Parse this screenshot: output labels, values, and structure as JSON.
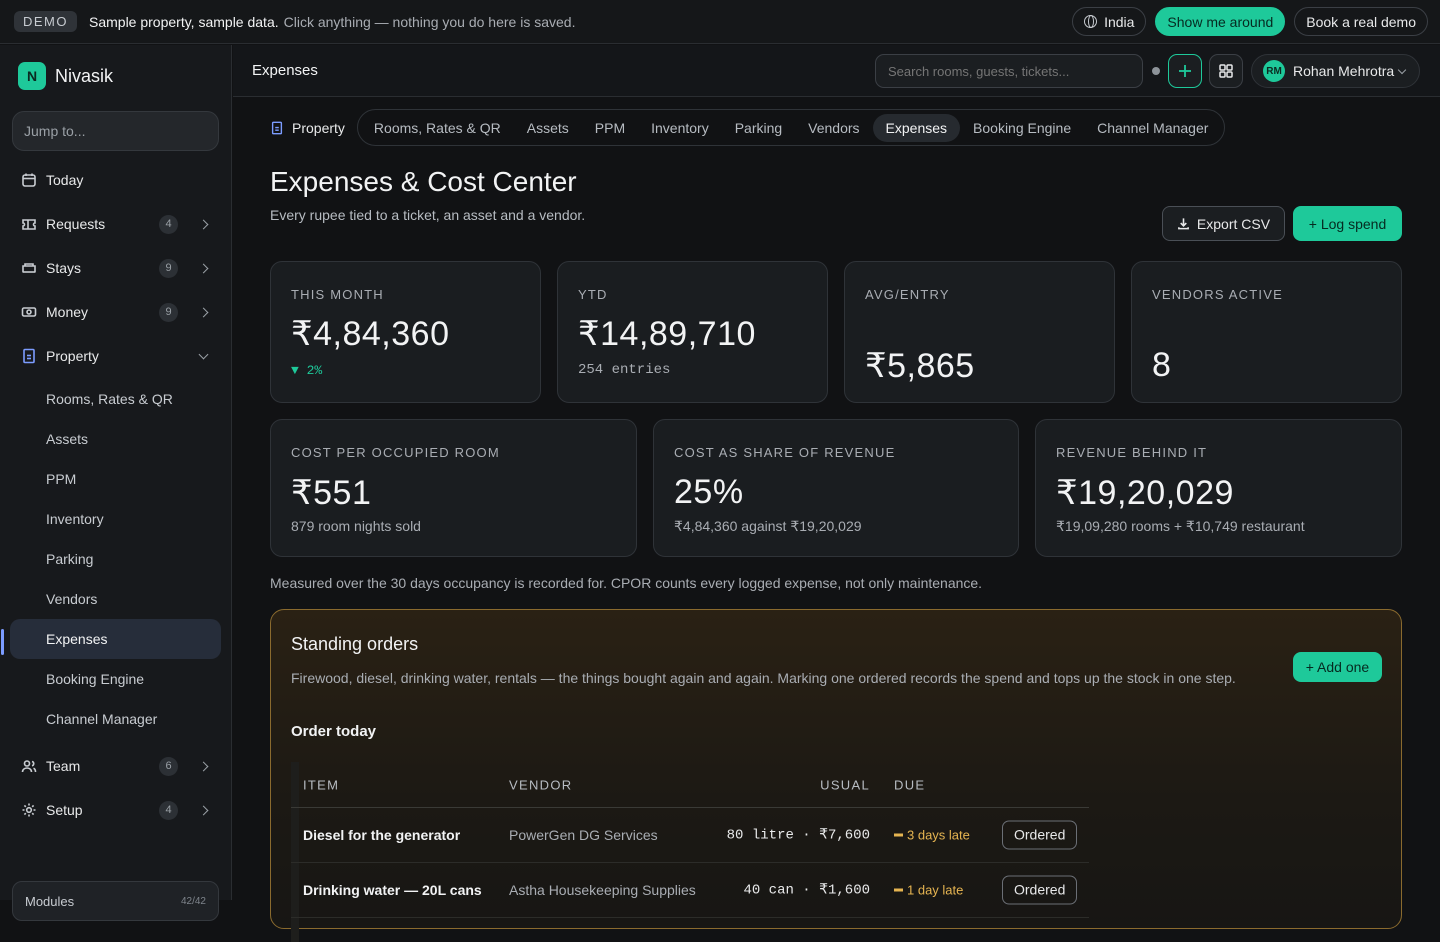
{
  "banner": {
    "badge": "DEMO",
    "strong": "Sample property, sample data.",
    "text": "Click anything — nothing you do here is saved.",
    "region": "India",
    "tour": "Show me around",
    "book": "Book a real demo"
  },
  "brand": {
    "logo": "N",
    "name": "Nivasik"
  },
  "sidebar": {
    "jump_placeholder": "Jump to...",
    "items": [
      {
        "label": "Today",
        "icon": "calendar-icon"
      },
      {
        "label": "Requests",
        "icon": "ticket-icon",
        "count": "4"
      },
      {
        "label": "Stays",
        "icon": "bed-icon",
        "count": "9"
      },
      {
        "label": "Money",
        "icon": "cash-icon",
        "count": "9"
      },
      {
        "label": "Property",
        "icon": "building-icon"
      }
    ],
    "property_children": [
      "Rooms, Rates & QR",
      "Assets",
      "PPM",
      "Inventory",
      "Parking",
      "Vendors",
      "Expenses",
      "Booking Engine",
      "Channel Manager"
    ],
    "bottom_items": [
      {
        "label": "Team",
        "icon": "users-icon",
        "count": "6"
      },
      {
        "label": "Setup",
        "icon": "gear-icon",
        "count": "4"
      }
    ],
    "modules": {
      "label": "Modules",
      "count": "42/42"
    }
  },
  "topbar": {
    "title": "Expenses",
    "search_placeholder": "Search rooms, guests, tickets...",
    "user_initials": "RM",
    "user_name": "Rohan Mehrotra"
  },
  "tabs": {
    "lead": "Property",
    "items": [
      "Rooms, Rates & QR",
      "Assets",
      "PPM",
      "Inventory",
      "Parking",
      "Vendors",
      "Expenses",
      "Booking Engine",
      "Channel Manager"
    ],
    "active": "Expenses"
  },
  "page": {
    "title": "Expenses & Cost Center",
    "subtitle": "Every rupee tied to a ticket, an asset and a vendor.",
    "export": "Export CSV",
    "log": "+ Log spend"
  },
  "kpis": [
    {
      "label": "THIS MONTH",
      "value": "₹4,84,360",
      "sub": "▼ 2%"
    },
    {
      "label": "YTD",
      "value": "₹14,89,710",
      "sub": "254 entries"
    },
    {
      "label": "AVG/ENTRY",
      "value": "₹5,865"
    },
    {
      "label": "VENDORS ACTIVE",
      "value": "8"
    }
  ],
  "kpis2": [
    {
      "label": "COST PER OCCUPIED ROOM",
      "value": "₹551",
      "sub": "879 room nights sold"
    },
    {
      "label": "COST AS SHARE OF REVENUE",
      "value": "25%",
      "sub": "₹4,84,360 against ₹19,20,029"
    },
    {
      "label": "REVENUE BEHIND IT",
      "value": "₹19,20,029",
      "sub": "₹19,09,280 rooms + ₹10,749 restaurant"
    }
  ],
  "note": "Measured over the 30 days occupancy is recorded for. CPOR counts every logged expense, not only maintenance.",
  "standing": {
    "title": "Standing orders",
    "desc": "Firewood, diesel, drinking water, rentals — the things bought again and again. Marking one ordered records the spend and tops up the stock in one step.",
    "add": "+ Add one",
    "today": "Order today",
    "headers": {
      "item": "ITEM",
      "vendor": "VENDOR",
      "usual": "USUAL",
      "due": "DUE"
    },
    "rows": [
      {
        "item": "Diesel for the generator",
        "vendor": "PowerGen DG Services",
        "usual": "80 litre · ₹7,600",
        "due": "3 days late",
        "action": "Ordered"
      },
      {
        "item": "Drinking water — 20L cans",
        "vendor": "Astha Housekeeping Supplies",
        "usual": "40 can · ₹1,600",
        "due": "1 day late",
        "action": "Ordered"
      }
    ]
  }
}
